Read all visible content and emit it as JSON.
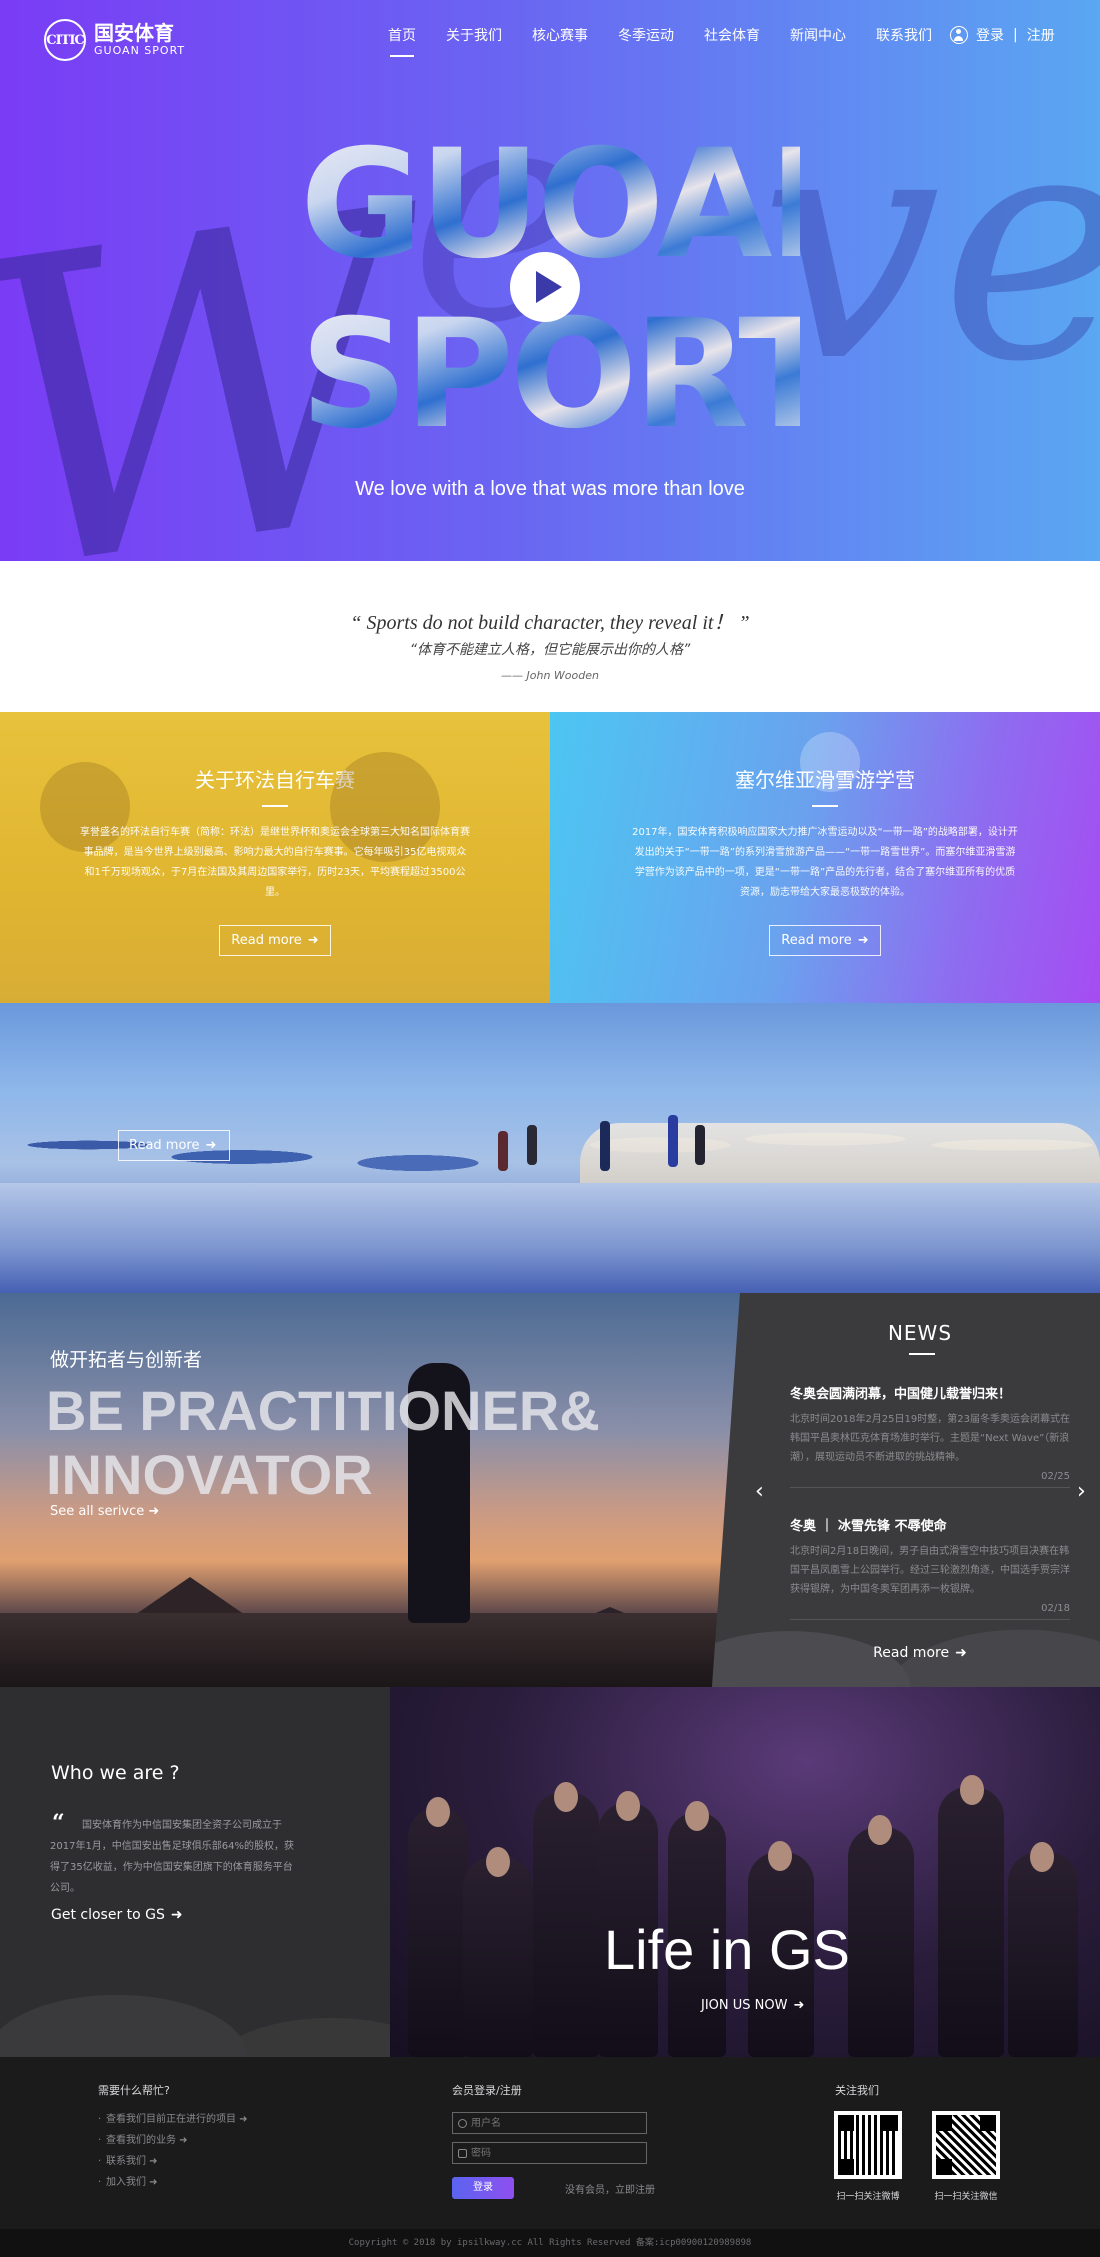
{
  "brand": {
    "cn": "国安体育",
    "en": "GUOAN SPORT",
    "mark": "CITIC"
  },
  "nav": {
    "items": [
      "首页",
      "关于我们",
      "核心赛事",
      "冬季运动",
      "社会体育",
      "新闻中心",
      "联系我们"
    ],
    "active": "首页",
    "login": "登录",
    "separator": "|",
    "register": "注册"
  },
  "hero": {
    "word1": "GUOAN",
    "word2": "SPORT",
    "script_left": "W",
    "script_mid": "e",
    "script_right": "ve",
    "tagline": "We love with a love that was more than love"
  },
  "quote": {
    "en": "“ Sports do not build character,  they reveal it！ ”",
    "cn": "“体育不能建立人格，但它能展示出你的人格”",
    "author": "—— John Wooden"
  },
  "panels": {
    "cycling": {
      "title": "关于环法自行车赛",
      "text": "享誉盛名的环法自行车赛（简称：环法）是继世界杯和奥运会全球第三大知名国际体育赛事品牌，是当今世界上级别最高、影响力最大的自行车赛事。它每年吸引35亿电视观众和1千万现场观众，于7月在法国及其周边国家举行，历时23天，平均赛程超过3500公里。",
      "button": "Read more"
    },
    "ski": {
      "title": "塞尔维亚滑雪游学营",
      "text": "2017年，国安体育积极响应国家大力推广冰雪运动以及“一带一路”的战略部署，设计开发出的关于“一带一路”的系列滑雪旅游产品——“一带一路雪世界”。而塞尔维亚滑雪游学营作为该产品中的一项，更是“一带一路”产品的先行者，结合了塞尔维亚所有的优质资源，励志带给大家最恶极致的体验。",
      "button": "Read more"
    }
  },
  "winter": {
    "button": "Read more"
  },
  "practitioner": {
    "cn": "做开拓者与创新者",
    "en": "BE PRACTITIONER& INNOVATOR",
    "link": "See all serivce"
  },
  "news": {
    "title": "NEWS",
    "items": [
      {
        "title": "冬奥会圆满闭幕，中国健儿载誉归来！",
        "body": "北京时间2018年2月25日19时整，第23届冬季奥运会闭幕式在韩国平昌奥林匹克体育场准时举行。主题是“Next Wave”（新浪潮），展现运动员不断进取的挑战精神。",
        "date": "02/25"
      },
      {
        "title": "冬奥 ｜ 冰雪先锋 不辱使命",
        "body": "北京时间2月18日晚间，男子自由式滑雪空中技巧项目决赛在韩国平昌凤凰雪上公园举行。经过三轮激烈角逐，中国选手贾宗洋获得银牌，为中国冬奥军团再添一枚银牌。",
        "date": "02/18"
      }
    ],
    "prev": "‹",
    "next": "›",
    "more": "Read more"
  },
  "who": {
    "title": "Who we are ?",
    "quote_mark": "“",
    "text": "国安体育作为中信国安集团全资子公司成立于2017年1月，中信国安出售足球俱乐部64%的股权，获得了35亿收益，作为中信国安集团旗下的体育服务平台公司。",
    "link": "Get closer to GS"
  },
  "life": {
    "title": "Life in GS",
    "link": "JION US NOW"
  },
  "footer": {
    "help": {
      "title": "需要什么帮忙?",
      "items": [
        "查看我们目前正在进行的项目",
        "查看我们的业务",
        "联系我们",
        "加入我们"
      ]
    },
    "login": {
      "title": "会员登录/注册",
      "username_placeholder": "用户名",
      "password_placeholder": "密码",
      "button": "登录",
      "register_text": "没有会员，立即注册"
    },
    "follow": {
      "title": "关注我们",
      "qr1_label": "扫一扫关注微博",
      "qr2_label": "扫一扫关注微信"
    }
  },
  "copyright": "Copyright © 2018 by ipsilkway.cc     All Rights Reserved     备案:icp00900120989898",
  "colors": {
    "hero_start": "#7a3cf5",
    "hero_end": "#5aa7f2",
    "panel_yellow": "#e0b530",
    "panel_purple": "#a64cf2",
    "news_bg": "#3b3b3d",
    "footer_bg": "#1b1b1c"
  }
}
